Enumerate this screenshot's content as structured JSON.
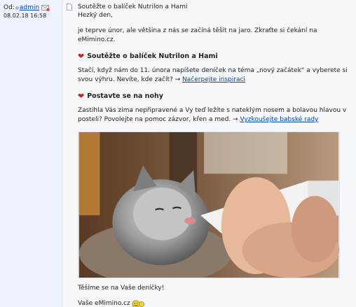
{
  "post": {
    "from_label": "Od:",
    "author": "admin",
    "date": "08.02.18 16:58",
    "subject": "Soutěžte o balíček Nutrilon a Hami"
  },
  "content": {
    "greeting": "Hezký den,",
    "intro": "je teprve únor, ale většina z nás se začíná těšit na jaro. Zkraťte si čekání na eMimino.cz.",
    "sections": [
      {
        "heading": "Soutěžte o balíček Nutrilon a Hami",
        "text": "Stačí, když nám do 11. února napíšete deníček na téma „nový začátek“ a vyberete si svou výhru. Nevíte, kde začít? →",
        "link": "Načerpejte inspiraci"
      },
      {
        "heading": "Postavte se na nohy",
        "text": "Zastihla Vás zima nepřipravené a Vy teď ležíte s nateklým nosem a bolavou hlavou v posteli? Povolejte na pomoc zázvor, křen a med. →",
        "link": "Vyzkoušejte babské rady"
      }
    ],
    "closing": "Těšíme se na Vaše deníčky!",
    "signature": "Vaše eMimino.cz"
  },
  "icons": {
    "heart": "heart-icon",
    "mail": "mail-icon",
    "doc": "document-icon",
    "smiley": "smiley-icon"
  },
  "colors": {
    "link": "#0645ad",
    "heart": "#c0262c",
    "sidebar_bg": "#eef3fb",
    "message_bg": "#f5f7fb"
  }
}
